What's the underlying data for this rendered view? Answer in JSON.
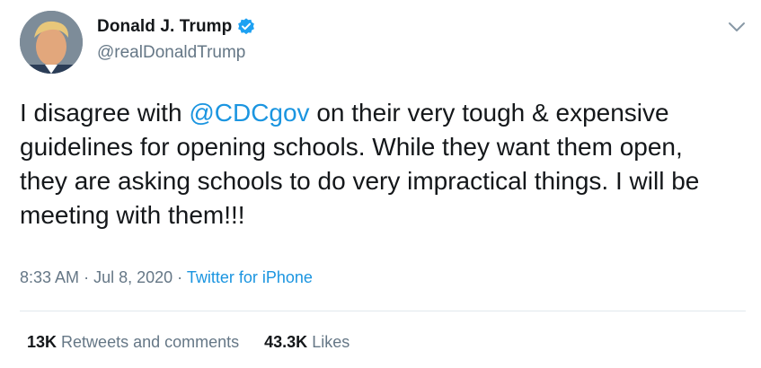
{
  "author": {
    "display_name": "Donald J. Trump",
    "handle": "@realDonaldTrump",
    "verified": true,
    "avatar_icon": "profile-photo"
  },
  "tweet": {
    "text_before": "I disagree with ",
    "mention": "@CDCgov",
    "text_after": " on their very tough & expensive guidelines for opening schools. While they want them open, they are asking schools to do very impractical things. I will be meeting with them!!!"
  },
  "meta": {
    "time": "8:33 AM",
    "separator": "·",
    "date": "Jul 8, 2020",
    "source": "Twitter for iPhone"
  },
  "stats": {
    "retweets_count": "13K",
    "retweets_label": "Retweets and comments",
    "likes_count": "43.3K",
    "likes_label": "Likes"
  },
  "colors": {
    "link": "#1b95e0",
    "muted": "#657786",
    "text": "#14171a",
    "verified_badge": "#1da1f2"
  }
}
